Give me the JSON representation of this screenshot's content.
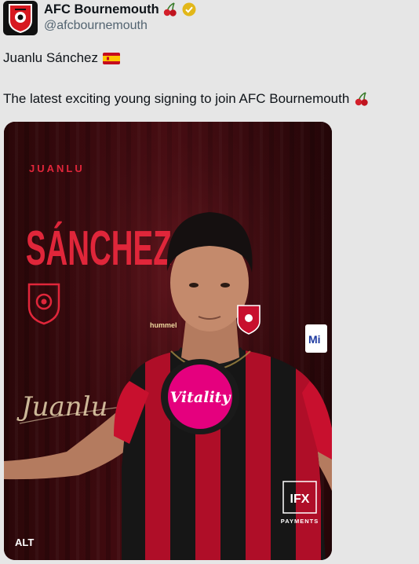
{
  "account": {
    "display_name": "AFC Bournemouth",
    "handle": "@afcbournemouth",
    "emoji_icon": "cherries-icon",
    "verified_icon": "verified-gold-badge-icon"
  },
  "tweet": {
    "line1": "Juanlu Sánchez",
    "line1_icon": "spain-flag-icon",
    "line2": "The latest exciting young signing to join AFC Bournemouth",
    "line2_icon": "cherries-icon"
  },
  "media": {
    "poster_first_name": "JUANLU",
    "poster_last_name": "SÁNCHEZ",
    "signature": "Juanlu",
    "shirt_sponsor": "Vitality",
    "kit_brand": "hummel",
    "sleeve_sponsor": "Mi",
    "ifx_logo": "IFX",
    "ifx_label": "PAYMENTS",
    "alt_label": "ALT"
  },
  "colors": {
    "accent_red": "#c8102e",
    "sponsor_pink": "#e5007e",
    "verified_gold": "#e2b719"
  }
}
